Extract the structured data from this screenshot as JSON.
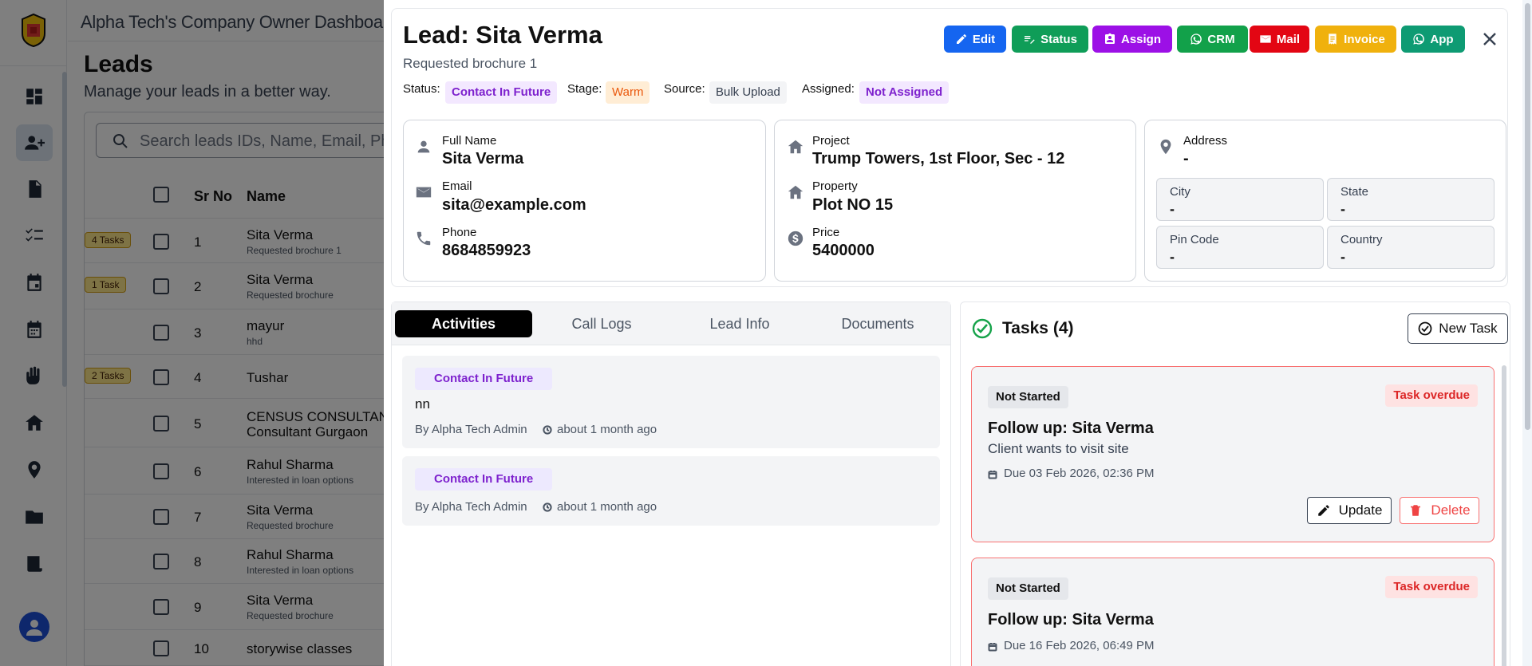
{
  "app": {
    "topbar_title": "Alpha Tech's Company Owner Dashboard",
    "page_title": "Leads",
    "page_subtitle": "Manage your leads in a better way.",
    "search_placeholder": "Search leads IDs, Name, Email, Ph",
    "table_headers": {
      "sr_no": "Sr No",
      "name": "Name"
    },
    "rows": [
      {
        "badge": "4 Tasks",
        "sr": "1",
        "name": "Sita Verma",
        "sub": "Requested brochure 1"
      },
      {
        "badge": "1 Task",
        "sr": "2",
        "name": "Sita Verma",
        "sub": "Requested brochure"
      },
      {
        "badge": "",
        "sr": "3",
        "name": "mayur",
        "sub": "hhd"
      },
      {
        "badge": "2 Tasks",
        "sr": "4",
        "name": "Tushar",
        "sub": ""
      },
      {
        "badge": "",
        "sr": "5",
        "name": "CENSUS CONSULTAN",
        "sub": "Consultant Gurgaon"
      },
      {
        "badge": "",
        "sr": "6",
        "name": "Rahul Sharma",
        "sub": "Interested in loan options"
      },
      {
        "badge": "",
        "sr": "7",
        "name": "Sita Verma",
        "sub": "Requested brochure"
      },
      {
        "badge": "",
        "sr": "8",
        "name": "Rahul Sharma",
        "sub": "Interested in loan options"
      },
      {
        "badge": "",
        "sr": "9",
        "name": "Sita Verma",
        "sub": "Requested brochure"
      },
      {
        "badge": "",
        "sr": "10",
        "name": "storywise classes",
        "sub": ""
      }
    ]
  },
  "lead": {
    "title": "Lead: Sita Verma",
    "subtitle": "Requested brochure 1",
    "actions": {
      "edit": "Edit",
      "status": "Status",
      "assign": "Assign",
      "crm": "CRM",
      "mail": "Mail",
      "invoice": "Invoice",
      "app": "App"
    },
    "meta": {
      "status_label": "Status:",
      "status_value": "Contact In Future",
      "stage_label": "Stage:",
      "stage_value": "Warm",
      "source_label": "Source:",
      "source_value": "Bulk Upload",
      "assigned_label": "Assigned:",
      "assigned_value": "Not Assigned"
    },
    "contact": {
      "full_name_label": "Full Name",
      "full_name": "Sita Verma",
      "email_label": "Email",
      "email": "sita@example.com",
      "phone_label": "Phone",
      "phone": "8684859923"
    },
    "property": {
      "project_label": "Project",
      "project": "Trump Towers, 1st Floor, Sec - 12",
      "property_label": "Property",
      "property": "Plot NO 15",
      "price_label": "Price",
      "price": "5400000"
    },
    "address": {
      "address_label": "Address",
      "address": "-",
      "city_label": "City",
      "city": "-",
      "state_label": "State",
      "state": "-",
      "pin_label": "Pin Code",
      "pin": "-",
      "country_label": "Country",
      "country": "-"
    }
  },
  "tabs": [
    "Activities",
    "Call Logs",
    "Lead Info",
    "Documents"
  ],
  "activities": [
    {
      "status": "Contact In Future",
      "note": "nn",
      "by": "By Alpha Tech Admin",
      "time": "about 1 month ago"
    },
    {
      "status": "Contact In Future",
      "note": "",
      "by": "By Alpha Tech Admin",
      "time": "about 1 month ago"
    }
  ],
  "tasks_panel": {
    "title": "Tasks (4)",
    "new_task": "New Task",
    "tasks": [
      {
        "status": "Not Started",
        "overdue": "Task overdue",
        "title": "Follow up: Sita Verma",
        "desc": "Client wants to visit site",
        "due": "Due 03 Feb 2026, 02:36 PM",
        "update": "Update",
        "delete": "Delete"
      },
      {
        "status": "Not Started",
        "overdue": "Task overdue",
        "title": "Follow up: Sita Verma",
        "desc": "",
        "due": "Due 16 Feb 2026, 06:49 PM"
      }
    ]
  },
  "colors": {
    "edit": "#1565f0",
    "status": "#0f9d58",
    "assign": "#9c10e6",
    "crm": "#12a14a",
    "mail": "#e30613",
    "invoice": "#f0b10d",
    "app": "#0e9b73",
    "status_chip_bg": "#f3e8ff",
    "status_chip_fg": "#7e22ce",
    "stage_chip_bg": "#ffedd5",
    "stage_chip_fg": "#ea580c",
    "source_chip_bg": "#f3f4f6",
    "assigned_chip_bg": "#f3e8ff"
  }
}
